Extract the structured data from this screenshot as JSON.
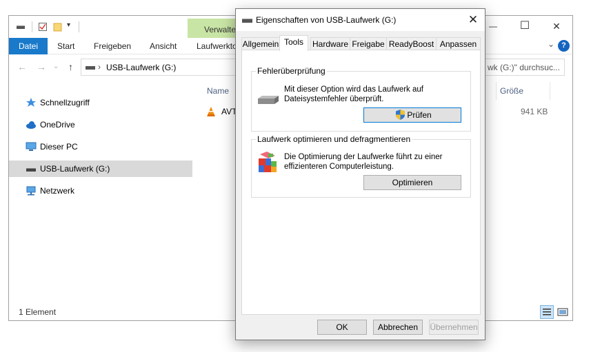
{
  "explorer": {
    "ribbon_context_tab": "Verwalten",
    "ribbon_tabs": [
      "Datei",
      "Start",
      "Freigeben",
      "Ansicht",
      "Laufwerkto"
    ],
    "address": "USB-Laufwerk (G:)",
    "search_placeholder": "wk (G:)\" durchsuc...",
    "sidebar": [
      {
        "label": "Schnellzugriff",
        "icon": "star-icon"
      },
      {
        "label": "OneDrive",
        "icon": "cloud-icon"
      },
      {
        "label": "Dieser PC",
        "icon": "computer-icon"
      },
      {
        "label": "USB-Laufwerk (G:)",
        "icon": "usb-drive-icon",
        "selected": true
      },
      {
        "label": "Netzwerk",
        "icon": "network-icon"
      }
    ],
    "columns": {
      "name": "Name",
      "size": "Größe"
    },
    "file": {
      "name": "AVT",
      "size": "941 KB"
    },
    "status": "1 Element",
    "window_buttons": {
      "minimize": "—",
      "maximize": "☐",
      "close": "✕"
    }
  },
  "dialog": {
    "title": "Eigenschaften von USB-Laufwerk (G:)",
    "close_glyph": "✕",
    "tabs": [
      "Allgemein",
      "Tools",
      "Hardware",
      "Freigabe",
      "ReadyBoost",
      "Anpassen"
    ],
    "active_tab": "Tools",
    "error_check": {
      "title": "Fehlerüberprüfung",
      "text": "Mit dieser Option wird das Laufwerk auf Dateisystemfehler überprüft.",
      "button": "Prüfen"
    },
    "optimize": {
      "title": "Laufwerk optimieren und defragmentieren",
      "text": "Die Optimierung der Laufwerke führt zu einer effizienteren Computerleistung.",
      "button": "Optimieren"
    },
    "footer": {
      "ok": "OK",
      "cancel": "Abbrechen",
      "apply": "Übernehmen"
    }
  },
  "colors": {
    "accent": "#1979ca",
    "context_tab": "#c9e5a5",
    "selected_row": "#d9d9d9"
  }
}
